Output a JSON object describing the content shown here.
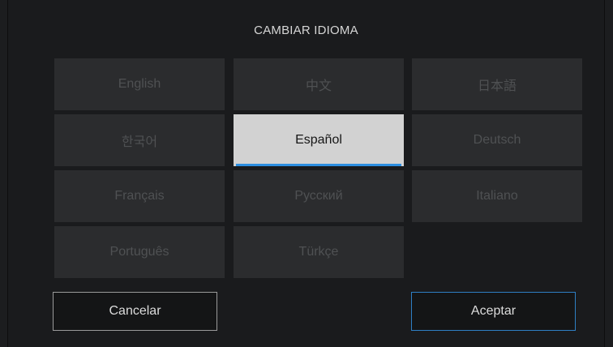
{
  "dialog": {
    "title": "CAMBIAR IDIOMA"
  },
  "languages": [
    {
      "label": "English",
      "selected": false
    },
    {
      "label": "中文",
      "selected": false
    },
    {
      "label": "日本語",
      "selected": false
    },
    {
      "label": "한국어",
      "selected": false
    },
    {
      "label": "Español",
      "selected": true
    },
    {
      "label": "Deutsch",
      "selected": false
    },
    {
      "label": "Français",
      "selected": false
    },
    {
      "label": "Русский",
      "selected": false
    },
    {
      "label": "Italiano",
      "selected": false
    },
    {
      "label": "Português",
      "selected": false
    },
    {
      "label": "Türkçe",
      "selected": false
    }
  ],
  "buttons": {
    "cancel_label": "Cancelar",
    "accept_label": "Aceptar"
  },
  "colors": {
    "accent": "#2c8ee0",
    "background": "#1a1b1d",
    "tile": "#2b2c2e",
    "tile_selected": "#d2d2d2"
  }
}
